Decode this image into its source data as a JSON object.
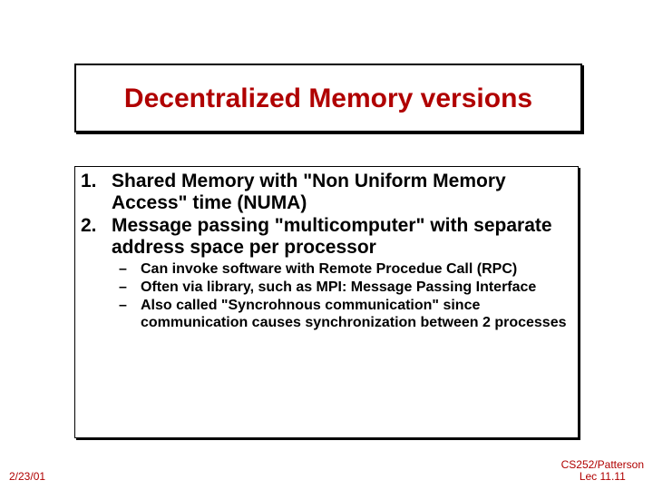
{
  "title": "Decentralized Memory versions",
  "list": {
    "item1_num": "1.",
    "item1_text": "Shared Memory with \"Non Uniform Memory Access\" time (NUMA)",
    "item2_num": "2.",
    "item2_text": "Message passing \"multicomputer\" with separate address space per processor",
    "sub1_dash": "–",
    "sub1_text": "Can invoke software with Remote Procedue Call (RPC)",
    "sub2_dash": "–",
    "sub2_text": "Often via library, such as MPI: Message Passing Interface",
    "sub3_dash": "–",
    "sub3_text": "Also called \"Syncrohnous communication\" since communication causes synchronization between 2 processes"
  },
  "footer": {
    "date": "2/23/01",
    "right1": "CS252/Patterson",
    "right2": "Lec 11.11"
  }
}
